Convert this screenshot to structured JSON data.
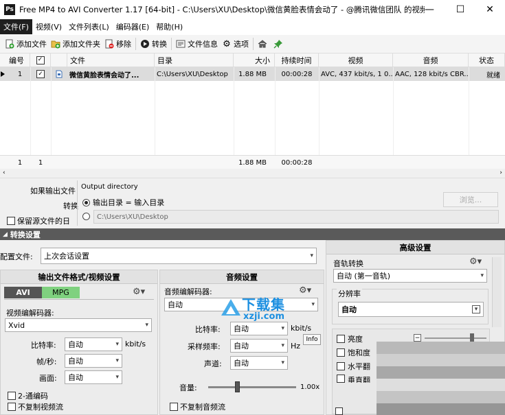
{
  "window": {
    "app_icon": "Ps",
    "title": "Free MP4 to AVI Converter 1.17  [64-bit] - C:\\Users\\XU\\Desktop\\微信黄脸表情会动了 - @腾讯微信团队 的视频.m...",
    "minimize": "—",
    "maximize": "☐",
    "close": "✕"
  },
  "menu": [
    "文件(F)",
    "视频(V)",
    "文件列表(L)",
    "编码器(E)",
    "帮助(H)"
  ],
  "toolbar": {
    "add_file": "添加文件",
    "add_folder": "添加文件夹",
    "remove": "移除",
    "convert": "转换",
    "file_info": "文件信息",
    "options": "选项"
  },
  "table": {
    "headers": [
      "编号",
      "☑",
      "文件",
      "目录",
      "大小",
      "持续时间",
      "视频",
      "音频",
      "状态"
    ],
    "rows": [
      {
        "num": "1",
        "file": "微信黄脸表情会动了...",
        "dir": "C:\\Users\\XU\\Desktop",
        "size": "1.88 MB",
        "duration": "00:00:28",
        "video": "AVC, 437 kbit/s, 1 0...",
        "audio": "AAC, 128 kbit/s CBR...",
        "status": "就绪"
      }
    ],
    "footer": {
      "count": "1",
      "checked": "1",
      "size": "1.88 MB",
      "duration": "00:00:28"
    }
  },
  "output": {
    "left_label1": "如果输出文件",
    "left_label2": "转换",
    "keep_label": "保留源文件的日",
    "group_title": "Output directory",
    "option1": "输出目录 = 输入目录",
    "path": "C:\\Users\\XU\\Desktop",
    "browse": "浏览..."
  },
  "convert_settings": {
    "title": "转换设置",
    "profile_label": "配置文件:",
    "profile_value": "上次会话设置"
  },
  "video_panel": {
    "title": "输出文件格式/视频设置",
    "tab_avi": "AVI",
    "tab_mpg": "MPG",
    "codec_label": "视频编解码器:",
    "codec_value": "Xvid",
    "bitrate_label": "比特率:",
    "bitrate_value": "自动",
    "bitrate_unit": "kbit/s",
    "fps_label": "帧/秒:",
    "fps_value": "自动",
    "size_label": "画面:",
    "size_value": "自动",
    "twopass": "2-通编码",
    "nocopy": "不复制视频流"
  },
  "audio_panel": {
    "title": "音频设置",
    "codec_label": "音频编解码器:",
    "codec_value": "自动",
    "bitrate_label": "比特率:",
    "bitrate_value": "自动",
    "bitrate_unit": "kbit/s",
    "samplerate_label": "采样频率:",
    "samplerate_value": "自动",
    "samplerate_unit": "Hz",
    "info": "Info",
    "channels_label": "声道:",
    "channels_value": "自动",
    "volume_label": "音量:",
    "volume_value": "1.00x",
    "volume_level": 0.33,
    "nocopy": "不复制音频流"
  },
  "advanced": {
    "title": "高级设置",
    "track_label": "音轨转换",
    "track_value": "自动 (第一音轨)",
    "resolution_label": "分辨率",
    "resolution_value": "自动",
    "brightness": "亮度",
    "saturation": "饱和度",
    "hflip": "水平翻",
    "vflip": "垂直翻"
  },
  "watermark": {
    "cn": "下载集",
    "url": "xzji.com"
  }
}
